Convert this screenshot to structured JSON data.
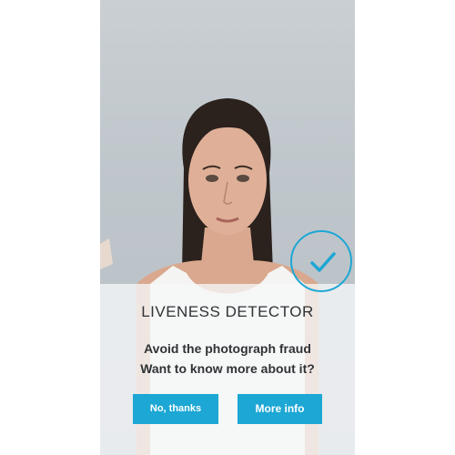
{
  "dialog": {
    "title": "LIVENESS DETECTOR",
    "subtitle_line1": "Avoid the photograph fraud",
    "subtitle_line2": "Want to know more about it?",
    "buttons": {
      "no": "No, thanks",
      "more": "More info"
    }
  },
  "status": {
    "icon": "checkmark-icon",
    "state": "verified"
  },
  "colors": {
    "accent": "#1ca7d4",
    "text": "#2f3336",
    "overlay": "#f6f7f8"
  }
}
